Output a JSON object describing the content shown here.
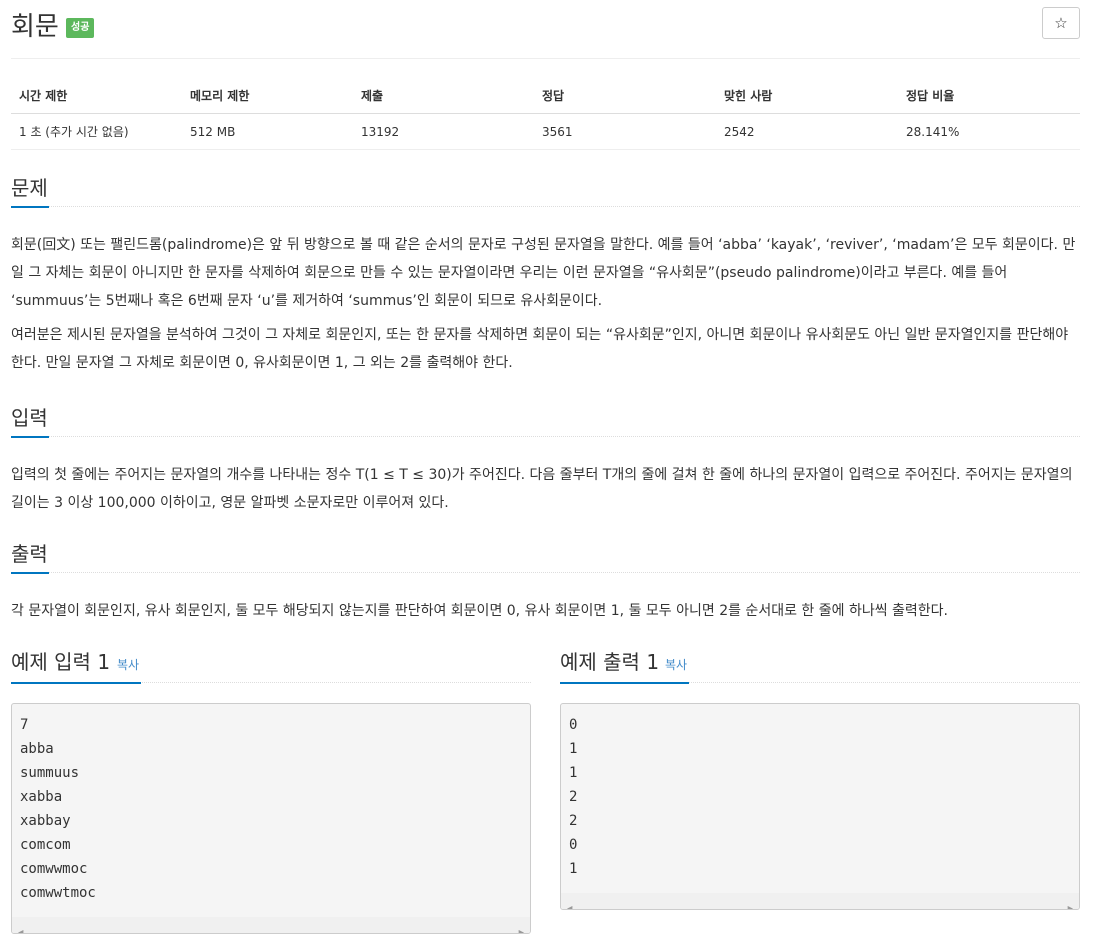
{
  "problem": {
    "title": "회문",
    "badge": "성공",
    "star_icon": "☆"
  },
  "info_table": {
    "headers": [
      "시간 제한",
      "메모리 제한",
      "제출",
      "정답",
      "맞힌 사람",
      "정답 비율"
    ],
    "values": [
      "1 초 (추가 시간 없음)",
      "512 MB",
      "13192",
      "3561",
      "2542",
      "28.141%"
    ]
  },
  "description": {
    "heading": "문제",
    "p1": "회문(回文) 또는 팰린드롬(palindrome)은 앞 뒤 방향으로 볼 때 같은 순서의 문자로 구성된 문자열을 말한다. 예를 들어 ‘abba’ ‘kayak’, ‘reviver’, ‘madam’은 모두 회문이다. 만일 그 자체는 회문이 아니지만 한 문자를 삭제하여 회문으로 만들 수 있는 문자열이라면 우리는 이런 문자열을 “유사회문”(pseudo palindrome)이라고 부른다. 예를 들어 ‘summuus’는 5번째나 혹은 6번째 문자 ‘u’를 제거하여 ‘summus’인 회문이 되므로 유사회문이다.",
    "p2": "여러분은 제시된 문자열을 분석하여 그것이 그 자체로 회문인지, 또는 한 문자를 삭제하면 회문이 되는 “유사회문”인지, 아니면 회문이나 유사회문도 아닌 일반 문자열인지를 판단해야 한다. 만일 문자열 그 자체로 회문이면 0, 유사회문이면 1, 그 외는 2를 출력해야 한다."
  },
  "input": {
    "heading": "입력",
    "p1": "입력의 첫 줄에는 주어지는 문자열의 개수를 나타내는 정수 T(1 ≤ T ≤ 30)가 주어진다. 다음 줄부터 T개의 줄에 걸쳐 한 줄에 하나의 문자열이 입력으로 주어진다. 주어지는 문자열의 길이는 3 이상 100,000 이하이고, 영문 알파벳 소문자로만 이루어져 있다."
  },
  "output": {
    "heading": "출력",
    "p1": "각 문자열이 회문인지, 유사 회문인지, 둘 모두 해당되지 않는지를 판단하여 회문이면 0, 유사 회문이면 1, 둘 모두 아니면 2를 순서대로 한 줄에 하나씩 출력한다."
  },
  "example_input": {
    "heading": "예제 입력 1",
    "copy": "복사",
    "lines": [
      "7",
      "abba",
      "summuus",
      "xabba",
      "xabbay",
      "comcom",
      "comwwmoc",
      "comwwtmoc"
    ]
  },
  "example_output": {
    "heading": "예제 출력 1",
    "copy": "복사",
    "lines": [
      "0",
      "1",
      "1",
      "2",
      "2",
      "0",
      "1"
    ]
  }
}
